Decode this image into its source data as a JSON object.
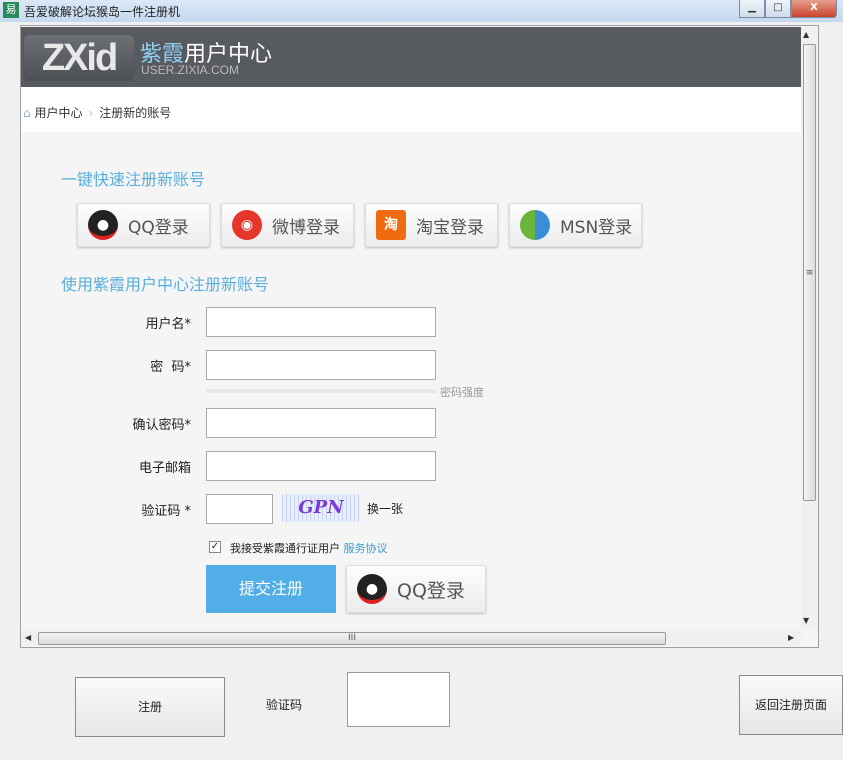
{
  "window": {
    "title": "吾爱破解论坛猴岛一件注册机",
    "icon": "易"
  },
  "header": {
    "logo": "ZXid",
    "brand_a": "紫霞",
    "brand_b": "用户中心",
    "url": "USER.ZIXIA.COM"
  },
  "breadcrumb": {
    "home": "用户中心",
    "current": "注册新的账号"
  },
  "quick": {
    "title": "一键快速注册新账号",
    "buttons": [
      {
        "label": "QQ登录",
        "icon": "qq-penguin-icon"
      },
      {
        "label": "微博登录",
        "icon": "weibo-icon"
      },
      {
        "label": "淘宝登录",
        "icon": "taobao-icon"
      },
      {
        "label": "MSN登录",
        "icon": "msn-icon"
      }
    ]
  },
  "form": {
    "title": "使用紫霞用户中心注册新账号",
    "username": "用户名*",
    "password": "密  码*",
    "strength": "密码强度",
    "confirm": "确认密码*",
    "email": "电子邮箱",
    "captcha": "验证码 *",
    "captcha_text": "GPN",
    "refresh": "换一张",
    "agree": "我接受紫霞通行证用户",
    "agree_link": "服务协议",
    "submit": "提交注册",
    "qq": "QQ登录"
  },
  "bottom": {
    "register": "注册",
    "captcha_label": "验证码",
    "back": "返回注册页面"
  },
  "colors": {
    "accent": "#52aee6",
    "header": "#575a5f"
  }
}
